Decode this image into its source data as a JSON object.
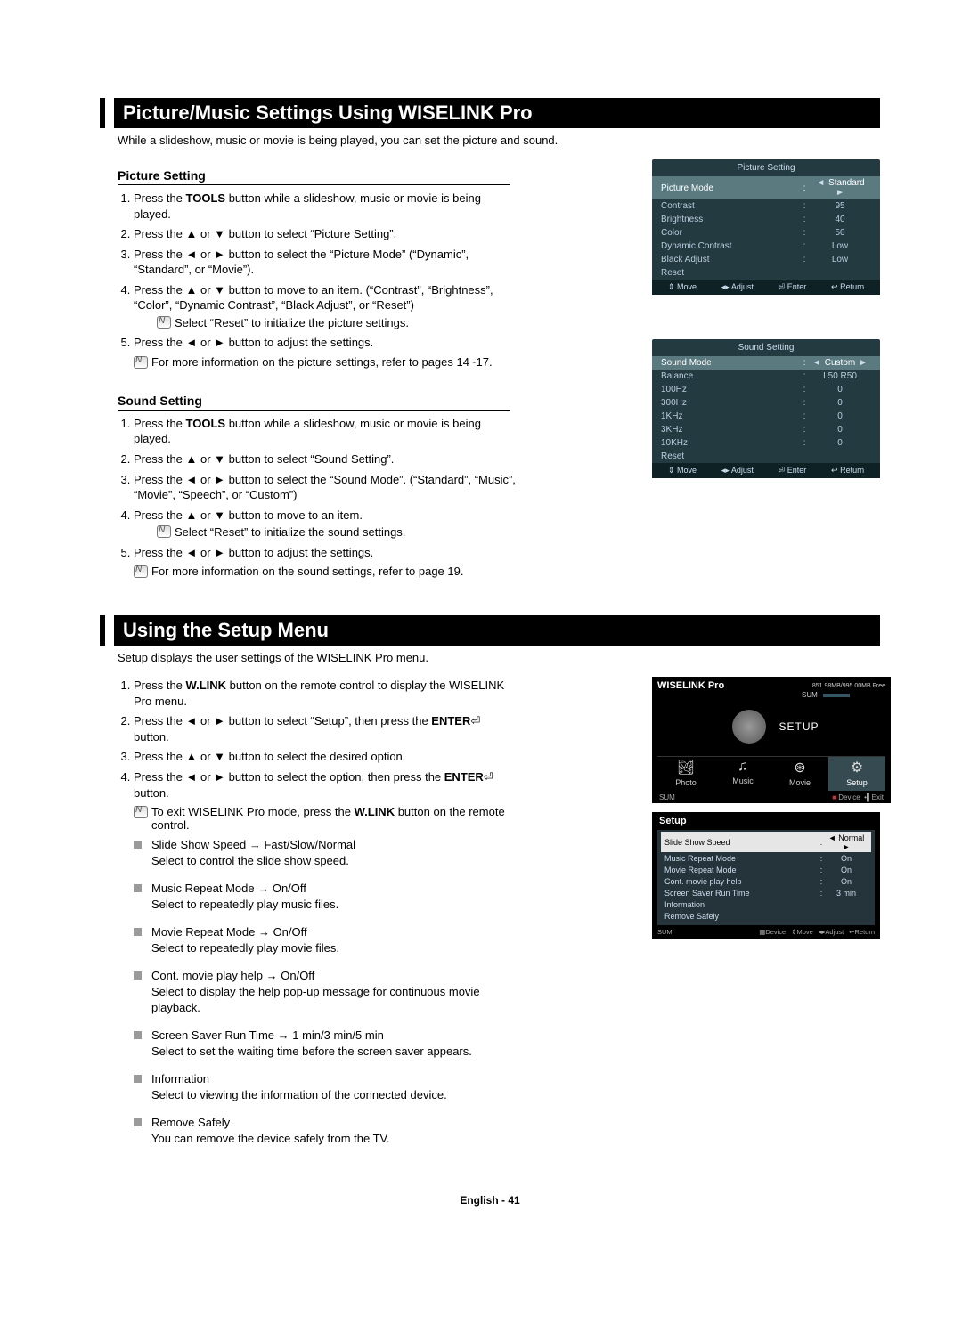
{
  "section1": {
    "heading": "Picture/Music Settings Using WISELINK Pro",
    "intro": "While a slideshow, music or movie is being played, you can set the picture and sound.",
    "picture": {
      "heading": "Picture Setting",
      "steps": [
        {
          "pre": "Press the ",
          "bold": "TOOLS",
          "post": " button while a slideshow, music or movie is being played."
        },
        {
          "text": "Press the ▲ or ▼ button to select “Picture Setting”."
        },
        {
          "text": "Press the ◄ or ► button to select the “Picture Mode” (“Dynamic”, “Standard”, or “Movie”)."
        },
        {
          "text": "Press the ▲ or ▼ button to move to an item. (“Contrast”, “Brightness”, “Color”, “Dynamic Contrast”, “Black Adjust”, or “Reset”)",
          "note": "Select “Reset” to initialize the picture settings."
        },
        {
          "text": "Press the ◄ or ► button to adjust the settings."
        }
      ],
      "endnote": "For more information on the picture settings, refer to pages 14~17."
    },
    "sound": {
      "heading": "Sound Setting",
      "steps": [
        {
          "pre": "Press the ",
          "bold": "TOOLS",
          "post": " button while a slideshow, music or movie is being played."
        },
        {
          "text": "Press the ▲ or ▼ button to select “Sound Setting”."
        },
        {
          "text": "Press the ◄ or ► button to select the “Sound Mode”. (“Standard”, “Music”, “Movie”, “Speech”, or “Custom”)"
        },
        {
          "text": "Press the ▲ or ▼ button to move to an item.",
          "note": "Select “Reset” to initialize the sound settings."
        },
        {
          "text": "Press the ◄ or ► button to adjust the settings."
        }
      ],
      "endnote": "For more information on the sound settings, refer to page 19."
    }
  },
  "osd_picture": {
    "title": "Picture Setting",
    "rows": [
      {
        "label": "Picture Mode",
        "value": "Standard",
        "sel": true,
        "arrows": true
      },
      {
        "label": "Contrast",
        "value": "95"
      },
      {
        "label": "Brightness",
        "value": "40"
      },
      {
        "label": "Color",
        "value": "50"
      },
      {
        "label": "Dynamic Contrast",
        "value": "Low"
      },
      {
        "label": "Black Adjust",
        "value": "Low"
      },
      {
        "label": "Reset",
        "value": ""
      }
    ],
    "footer": [
      "Move",
      "Adjust",
      "Enter",
      "Return"
    ],
    "footer_icons": [
      "⇕",
      "◂▸",
      "⏎",
      "↩"
    ]
  },
  "osd_sound": {
    "title": "Sound Setting",
    "rows": [
      {
        "label": "Sound Mode",
        "value": "Custom",
        "sel": true,
        "arrows": true
      },
      {
        "label": "Balance",
        "value": "L50 R50"
      },
      {
        "label": "100Hz",
        "value": "0"
      },
      {
        "label": "300Hz",
        "value": "0"
      },
      {
        "label": "1KHz",
        "value": "0"
      },
      {
        "label": "3KHz",
        "value": "0"
      },
      {
        "label": "10KHz",
        "value": "0"
      },
      {
        "label": "Reset",
        "value": ""
      }
    ],
    "footer": [
      "Move",
      "Adjust",
      "Enter",
      "Return"
    ],
    "footer_icons": [
      "⇕",
      "◂▸",
      "⏎",
      "↩"
    ]
  },
  "section2": {
    "heading": "Using the Setup Menu",
    "intro": "Setup displays the user settings of the WISELINK Pro menu.",
    "steps": [
      {
        "pre": "Press the ",
        "bold": "W.LINK",
        "post": " button on the remote control to display the WISELINK Pro menu."
      },
      {
        "pre": "Press the ◄ or ► button to select “Setup”, then press the ",
        "bold": "ENTER",
        "post": " button.",
        "enter": true
      },
      {
        "text": "Press the ▲ or ▼ button to select the desired option."
      },
      {
        "pre": "Press the ◄ or ► button to select the option, then press the ",
        "bold": "ENTER",
        "post": " button.",
        "enter": true
      }
    ],
    "exitnote_pre": "To exit WISELINK Pro mode, press the ",
    "exitnote_bold": "W.LINK",
    "exitnote_post": " button on the remote control.",
    "bullets": [
      {
        "title": "Slide Show Speed → Fast/Slow/Normal",
        "desc": "Select to control the slide show speed."
      },
      {
        "title": "Music Repeat Mode → On/Off",
        "desc": "Select to repeatedly play music files."
      },
      {
        "title": "Movie Repeat Mode → On/Off",
        "desc": "Select to repeatedly play movie files."
      },
      {
        "title": "Cont. movie play help → On/Off",
        "desc": "Select to display the help pop-up message for continuous movie playback."
      },
      {
        "title": "Screen Saver Run Time → 1 min/3 min/5 min",
        "desc": "Select to set the waiting time before the screen saver appears."
      },
      {
        "title": "Information",
        "desc": "Select to viewing the information of the connected device."
      },
      {
        "title": "Remove Safely",
        "desc": "You can remove the device safely from the TV."
      }
    ]
  },
  "wlp": {
    "title": "WISELINK Pro",
    "free": "851.98MB/995.00MB Free",
    "sum": "SUM",
    "center": "SETUP",
    "tabs": [
      {
        "label": "Photo",
        "icon": "🏞"
      },
      {
        "label": "Music",
        "icon": "♫"
      },
      {
        "label": "Movie",
        "icon": "⊛"
      },
      {
        "label": "Setup",
        "icon": "⚙",
        "active": true
      }
    ],
    "foot_left": "SUM",
    "foot_device": "Device",
    "foot_exit": "Exit"
  },
  "setup_osd": {
    "title": "Setup",
    "rows": [
      {
        "label": "Slide Show Speed",
        "value": "Normal",
        "sel": true,
        "arrows": true
      },
      {
        "label": "Music Repeat Mode",
        "value": "On"
      },
      {
        "label": "Movie Repeat Mode",
        "value": "On"
      },
      {
        "label": "Cont. movie play help",
        "value": "On"
      },
      {
        "label": "Screen Saver Run Time",
        "value": "3 min"
      },
      {
        "label": "Information",
        "value": ""
      },
      {
        "label": "Remove Safely",
        "value": ""
      }
    ],
    "foot_left": "SUM",
    "foot_right": [
      "Device",
      "Move",
      "Adjust",
      "Return"
    ],
    "foot_right_icons": [
      "▦",
      "⇕",
      "◂▸",
      "↩"
    ]
  },
  "footer": "English - 41"
}
